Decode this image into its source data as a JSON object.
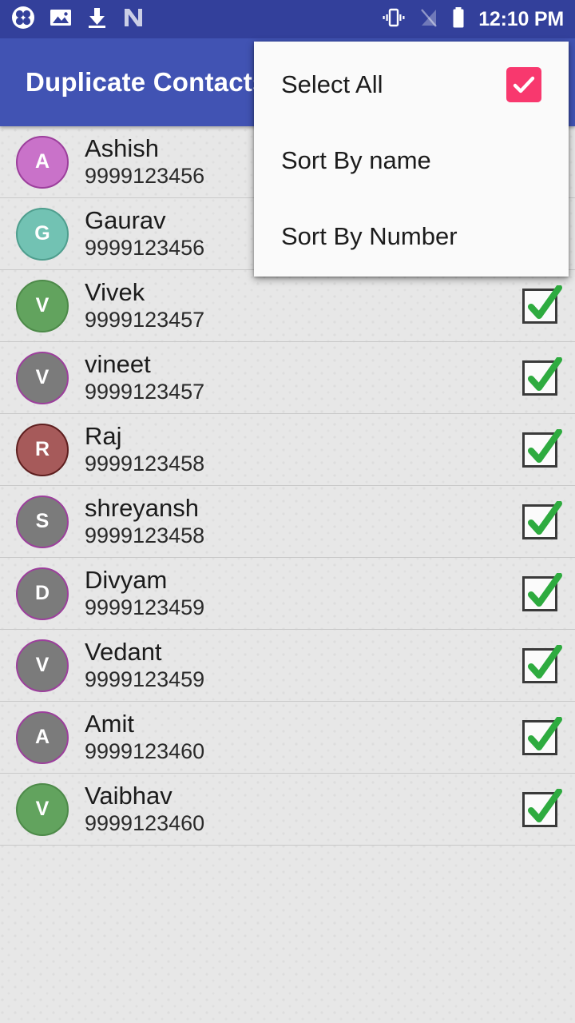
{
  "status_bar": {
    "background_color": "#33409b",
    "time": "12:10 PM",
    "left_icons": [
      {
        "name": "clover-app-icon",
        "label": "clover"
      },
      {
        "name": "photo-image-icon",
        "label": "image"
      },
      {
        "name": "download-icon",
        "label": "download"
      },
      {
        "name": "n-app-icon",
        "label": "N"
      }
    ],
    "right_icons": [
      {
        "name": "vibrate-icon",
        "label": "vibrate"
      },
      {
        "name": "signal-off-icon",
        "label": "no signal"
      },
      {
        "name": "battery-icon",
        "label": "battery"
      }
    ]
  },
  "app_bar": {
    "title": "Duplicate Contacts",
    "background_color": "#4153b3",
    "title_color": "#ffffff"
  },
  "menu": {
    "background_color": "#fafafa",
    "items": [
      {
        "label": "Select All",
        "has_checkbox": true,
        "checked": true,
        "checkbox_color": "#f8386e"
      },
      {
        "label": "Sort By name",
        "has_checkbox": false,
        "checked": false,
        "checkbox_color": ""
      },
      {
        "label": "Sort By Number",
        "has_checkbox": false,
        "checked": false,
        "checkbox_color": ""
      }
    ]
  },
  "contacts": {
    "checkbox_check_color": "#2eab3f",
    "items": [
      {
        "initial": "A",
        "name": "Ashish",
        "number": "9999123456",
        "avatar_color": "#c972c9",
        "avatar_border": "#9c3f9c",
        "checked": true
      },
      {
        "initial": "G",
        "name": "Gaurav",
        "number": "9999123456",
        "avatar_color": "#72c2b3",
        "avatar_border": "#4f9e8e",
        "checked": true
      },
      {
        "initial": "V",
        "name": "Vivek",
        "number": "9999123457",
        "avatar_color": "#62a35e",
        "avatar_border": "#4d8a49",
        "checked": true
      },
      {
        "initial": "V",
        "name": "vineet",
        "number": "9999123457",
        "avatar_color": "#7b7b7b",
        "avatar_border": "#9c3f9c",
        "checked": true
      },
      {
        "initial": "R",
        "name": "Raj",
        "number": "9999123458",
        "avatar_color": "#a65a5a",
        "avatar_border": "#5e1f1f",
        "checked": true
      },
      {
        "initial": "S",
        "name": "shreyansh",
        "number": "9999123458",
        "avatar_color": "#7b7b7b",
        "avatar_border": "#9c3f9c",
        "checked": true
      },
      {
        "initial": "D",
        "name": "Divyam",
        "number": "9999123459",
        "avatar_color": "#7b7b7b",
        "avatar_border": "#9c3f9c",
        "checked": true
      },
      {
        "initial": "V",
        "name": "Vedant",
        "number": "9999123459",
        "avatar_color": "#7b7b7b",
        "avatar_border": "#9c3f9c",
        "checked": true
      },
      {
        "initial": "A",
        "name": "Amit",
        "number": "9999123460",
        "avatar_color": "#7b7b7b",
        "avatar_border": "#9c3f9c",
        "checked": true
      },
      {
        "initial": "V",
        "name": "Vaibhav",
        "number": "9999123460",
        "avatar_color": "#62a35e",
        "avatar_border": "#4d8a49",
        "checked": true
      }
    ]
  }
}
